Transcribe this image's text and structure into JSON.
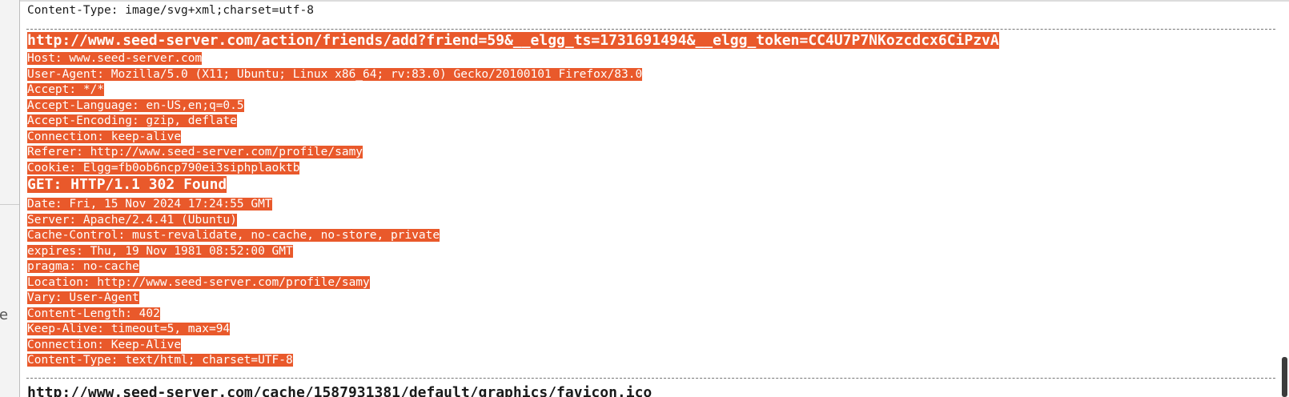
{
  "gutter": {
    "glyph": "e"
  },
  "log": {
    "prev_content_type": "Content-Type: image/svg+xml;charset=utf-8",
    "request": {
      "url": "http://www.seed-server.com/action/friends/add?friend=59&__elgg_ts=1731691494&__elgg_token=CC4U7P7NKozcdcx6CiPzvA",
      "headers": [
        "Host: www.seed-server.com",
        "User-Agent: Mozilla/5.0 (X11; Ubuntu; Linux x86_64; rv:83.0) Gecko/20100101 Firefox/83.0",
        "Accept: */*",
        "Accept-Language: en-US,en;q=0.5",
        "Accept-Encoding: gzip, deflate",
        "Connection: keep-alive",
        "Referer: http://www.seed-server.com/profile/samy",
        "Cookie: Elgg=fb0ob6ncp790ei3siphplaoktb"
      ]
    },
    "response": {
      "status": "GET: HTTP/1.1 302 Found",
      "headers": [
        "Date: Fri, 15 Nov 2024 17:24:55 GMT",
        "Server: Apache/2.4.41 (Ubuntu)",
        "Cache-Control: must-revalidate, no-cache, no-store, private",
        "expires: Thu, 19 Nov 1981 08:52:00 GMT",
        "pragma: no-cache",
        "Location: http://www.seed-server.com/profile/samy",
        "Vary: User-Agent",
        "Content-Length: 402",
        "Keep-Alive: timeout=5, max=94",
        "Connection: Keep-Alive",
        "Content-Type: text/html; charset=UTF-8"
      ]
    },
    "next_url_partial": "http://www.seed-server.com/cache/1587931381/default/graphics/favicon.ico"
  },
  "colors": {
    "highlight": "#e9592b",
    "highlight_text": "#ffffff"
  }
}
